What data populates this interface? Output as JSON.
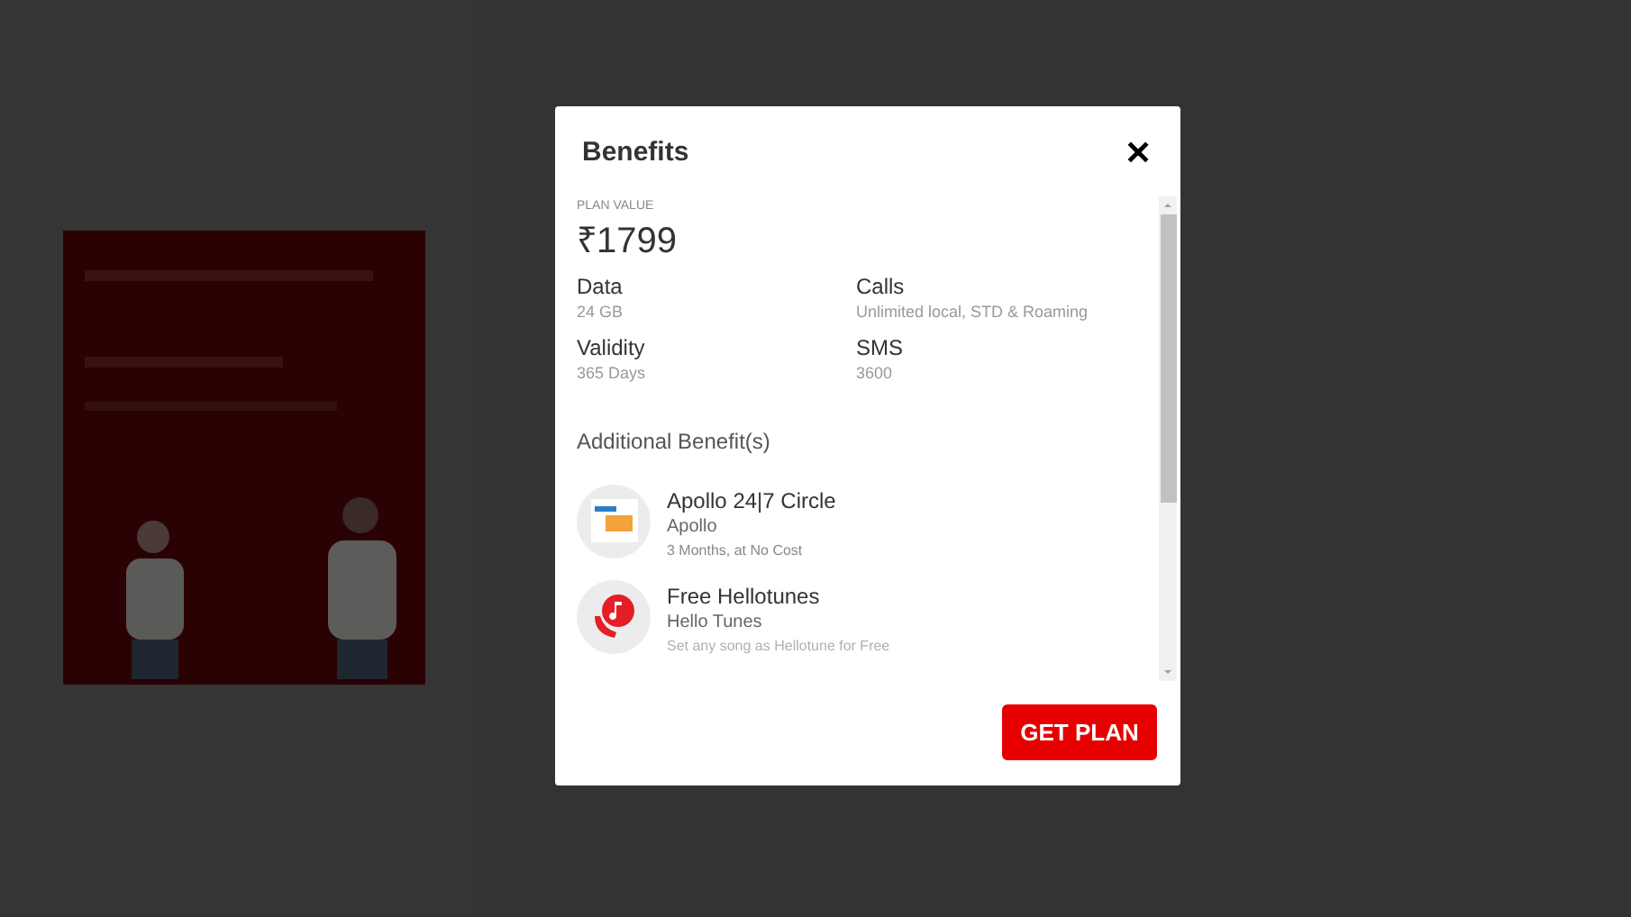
{
  "dialog": {
    "title": "Benefits",
    "close": "✕",
    "plan_value": {
      "label": "PLAN VALUE",
      "amount": "₹1799"
    },
    "features": [
      {
        "label": "Data",
        "value": "24 GB"
      },
      {
        "label": "Calls",
        "value": "Unlimited local, STD & Roaming"
      },
      {
        "label": "Validity",
        "value": "365 Days"
      },
      {
        "label": "SMS",
        "value": "3600"
      }
    ],
    "additional_heading": "Additional Benefit(s)",
    "benefits": [
      {
        "kind": "apollo",
        "title": "Apollo 24|7 Circle",
        "provider": "Apollo",
        "detail": "3 Months, at No Cost"
      },
      {
        "kind": "hellotunes",
        "title": "Free Hellotunes",
        "provider": "Hello Tunes",
        "detail": "Set any song as Hellotune for Free"
      }
    ],
    "button": "GET PLAN"
  }
}
